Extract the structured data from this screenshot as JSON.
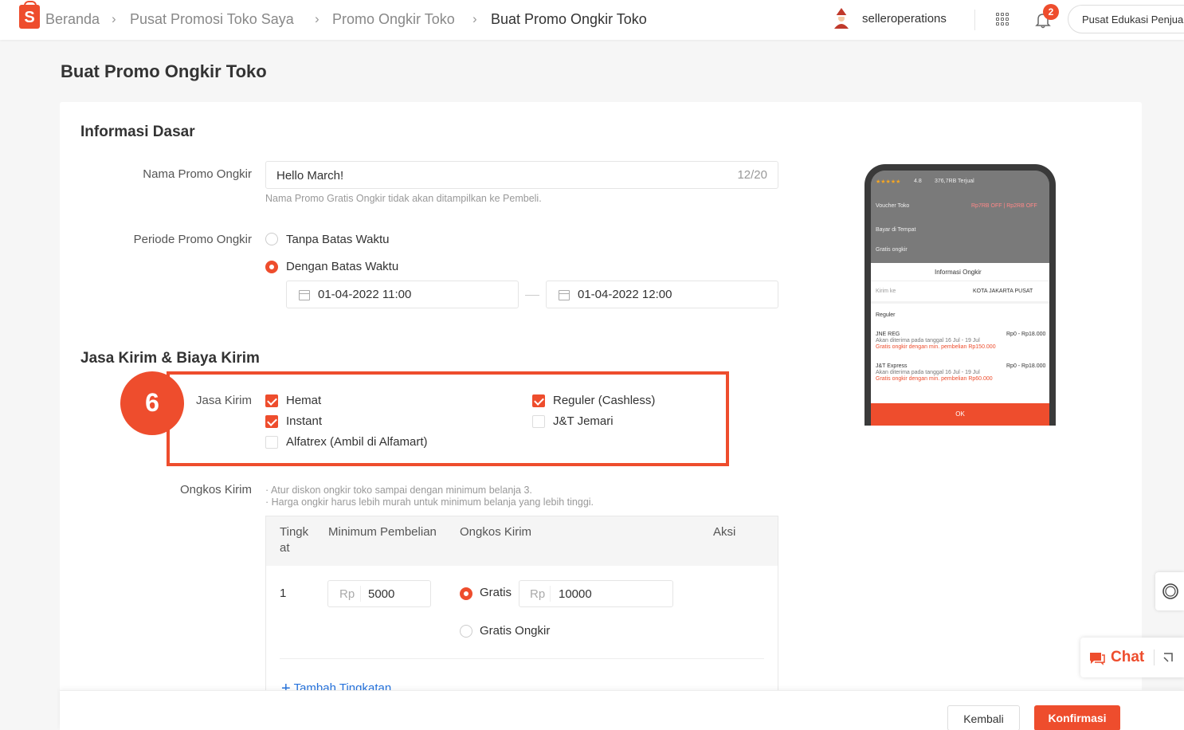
{
  "breadcrumb": {
    "home": "Beranda",
    "level1": "Pusat Promosi Toko Saya",
    "level2": "Promo Ongkir Toko",
    "current": "Buat Promo Ongkir Toko"
  },
  "header": {
    "username": "selleroperations",
    "notification_count": "2",
    "edu_label": "Pusat Edukasi Penjual",
    "logo_letter": "S"
  },
  "page_title": "Buat Promo Ongkir Toko",
  "basic_info": {
    "section_title": "Informasi Dasar",
    "name_label": "Nama Promo Ongkir",
    "name_value": "Hello March!",
    "name_counter": "12/20",
    "name_hint": "Nama Promo Gratis Ongkir tidak akan ditampilkan ke Pembeli.",
    "period_label": "Periode Promo Ongkir",
    "period_option_unlimited": "Tanpa Batas Waktu",
    "period_option_limited": "Dengan Batas Waktu",
    "period_selected": "Dengan Batas Waktu",
    "start_date": "01-04-2022 11:00",
    "end_date": "01-04-2022 12:00"
  },
  "shipping": {
    "section_title": "Jasa Kirim & Biaya Kirim",
    "step_number": "6",
    "couriers_label": "Jasa Kirim",
    "couriers": [
      {
        "label": "Hemat",
        "checked": true
      },
      {
        "label": "Instant",
        "checked": true
      },
      {
        "label": "Alfatrex (Ambil di Alfamart)",
        "checked": false
      },
      {
        "label": "Reguler (Cashless)",
        "checked": true
      },
      {
        "label": "J&T Jemari",
        "checked": false
      }
    ],
    "cost_label": "Ongkos Kirim",
    "cost_hint_1": "· Atur diskon ongkir toko sampai dengan minimum belanja 3.",
    "cost_hint_2": "· Harga ongkir harus lebih murah untuk minimum belanja yang lebih tinggi.",
    "table": {
      "headers": [
        "Tingk at",
        "Minimum Pembelian",
        "Ongkos Kirim",
        "Aksi"
      ],
      "header_tier_line1": "Tingk",
      "header_tier_line2": "at",
      "rows": [
        {
          "tier": "1",
          "currency": "Rp",
          "min_purchase": "5000",
          "option_discount": "Gratis",
          "option_free": "Gratis Ongkir",
          "selected": "Gratis",
          "shipping_cost": "10000"
        }
      ],
      "add_tier_label": "Tambah Tingkatan"
    }
  },
  "preview": {
    "rating": "4.8",
    "sold": "376,7RB Terjual",
    "voucher_label": "Voucher Toko",
    "voucher_tags": "Rp7RB OFF | Rp2RB OFF",
    "cod_label": "Bayar di Tempat",
    "free_ship_label": "Gratis ongkir",
    "sheet_title": "Informasi Ongkir",
    "send_to_label": "Kirim ke",
    "send_to_value": "KOTA JAKARTA PUSAT",
    "reguler_label": "Reguler",
    "jne_name": "JNE REG",
    "jne_price": "Rp0 - Rp18.000",
    "jne_eta": "Akan diterima pada tanggal 16 Jul - 19 Jul",
    "jne_note": "Gratis ongkir dengan min. pembelian Rp150.000",
    "jnt_name": "J&T Express",
    "jnt_price": "Rp0 - Rp18.000",
    "jnt_eta": "Akan diterima pada tanggal 16 Jul - 19 Jul",
    "jnt_note": "Gratis ongkir dengan min. pembelian Rp60.000",
    "ok_label": "OK"
  },
  "footer": {
    "back_label": "Kembali",
    "confirm_label": "Konfirmasi"
  },
  "chat": {
    "label": "Chat"
  },
  "colors": {
    "accent": "#ee4d2d",
    "text": "#333333",
    "muted": "#999999"
  }
}
